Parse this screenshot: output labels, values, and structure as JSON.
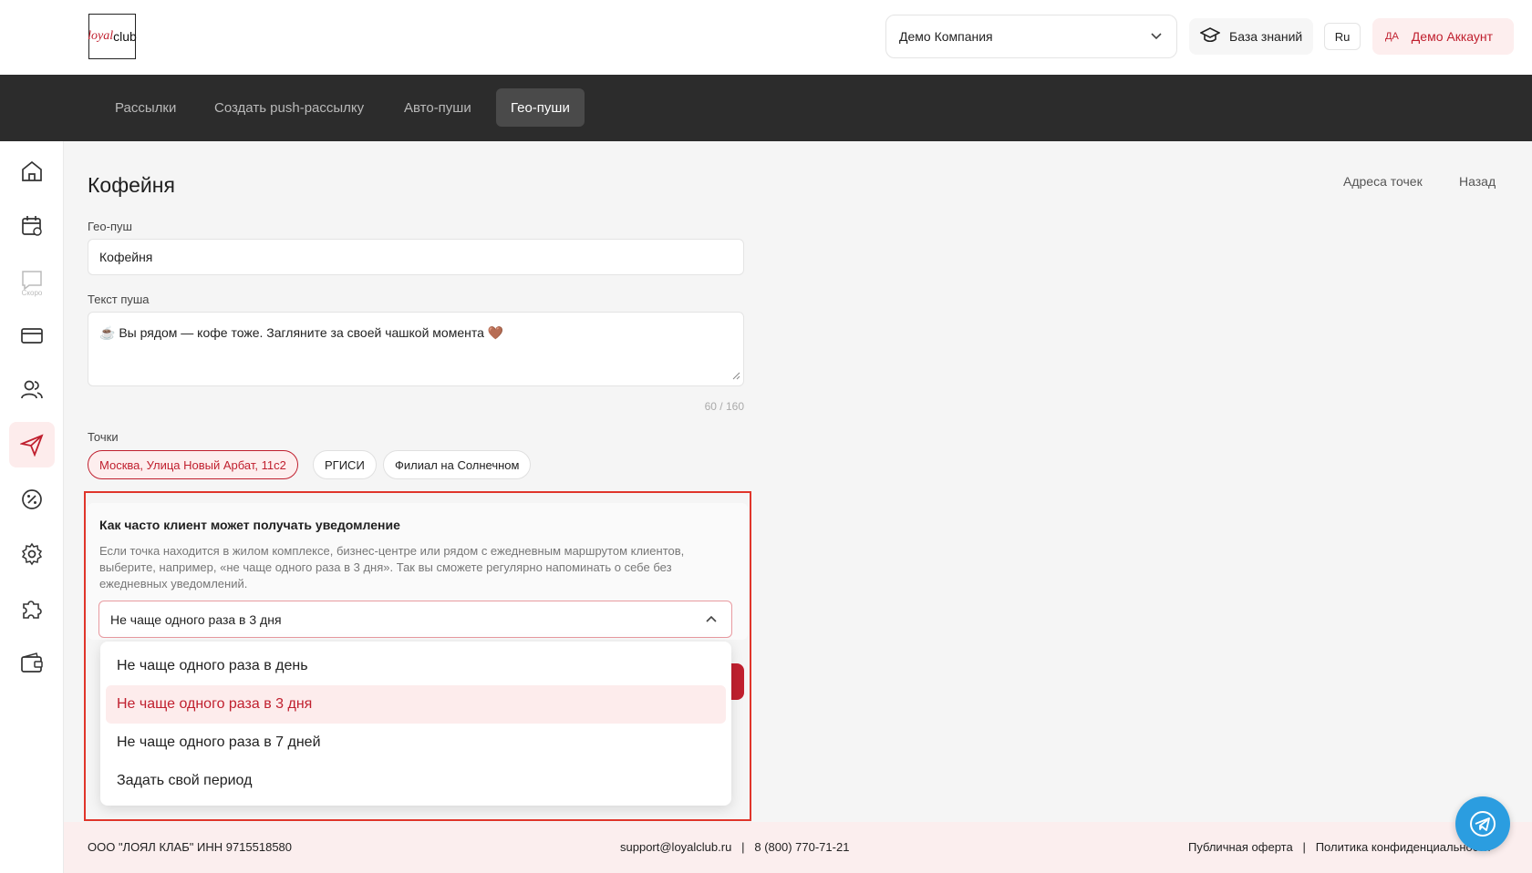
{
  "header": {
    "logo_text_1": "loyal",
    "logo_text_2": "club",
    "company": "Демо Компания",
    "knowledge_base": "База знаний",
    "language": "Ru",
    "account_initials": "ДА",
    "account_name": "Демо Аккаунт"
  },
  "nav": {
    "tabs": [
      {
        "label": "Рассылки",
        "active": false
      },
      {
        "label": "Создать push-рассылку",
        "active": false
      },
      {
        "label": "Авто-пуши",
        "active": false
      },
      {
        "label": "Гео-пуши",
        "active": true
      }
    ]
  },
  "sidebar": {
    "items": [
      {
        "icon": "home-icon"
      },
      {
        "icon": "calendar-icon"
      },
      {
        "icon": "chat-icon",
        "soon_label": "Скоро"
      },
      {
        "icon": "card-icon"
      },
      {
        "icon": "users-icon"
      },
      {
        "icon": "send-icon",
        "active": true
      },
      {
        "icon": "discount-icon"
      },
      {
        "icon": "gear-icon"
      },
      {
        "icon": "puzzle-icon"
      },
      {
        "icon": "wallet-icon"
      }
    ]
  },
  "page": {
    "title": "Кофейня",
    "addresses_link": "Адреса точек",
    "back_link": "Назад",
    "geo_push_label": "Гео-пуш",
    "geo_push_value": "Кофейня",
    "push_text_label": "Текст пуша",
    "push_text_value": "☕ Вы рядом — кофе тоже. Загляните за своей чашкой момента 🤎",
    "counter": "60 / 160",
    "points_label": "Точки",
    "points": [
      {
        "label": "Москва, Улица Новый Арбат, 11с2",
        "selected": true
      },
      {
        "label": "РГИСИ",
        "selected": false
      },
      {
        "label": "Филиал на Солнечном",
        "selected": false
      }
    ]
  },
  "frequency": {
    "title": "Как часто клиент может получать уведомление",
    "description": "Если точка находится в жилом комплексе, бизнес-центре или рядом с ежедневным маршрутом клиентов, выберите, например, «не чаще одного раза в 3 дня». Так вы сможете регулярно напоминать о себе без ежедневных уведомлений.",
    "selected": "Не чаще одного раза в 3 дня",
    "options": [
      {
        "label": "Не чаще одного раза в день",
        "active": false
      },
      {
        "label": "Не чаще одного раза в 3 дня",
        "active": true
      },
      {
        "label": "Не чаще одного раза в 7 дней",
        "active": false
      },
      {
        "label": "Задать свой период",
        "active": false
      }
    ]
  },
  "footer": {
    "company": "ООО \"ЛОЯЛ КЛАБ\" ИНН 9715518580",
    "contacts": "support@loyalclub.ru   |   8 (800) 770-71-21",
    "offer": "Публичная оферта   |   Политика конфиденциальности"
  },
  "colors": {
    "accent": "#c0202f",
    "navbar": "#2c2c2c",
    "highlight": "#e0352b",
    "telegram": "#2b9de0"
  }
}
